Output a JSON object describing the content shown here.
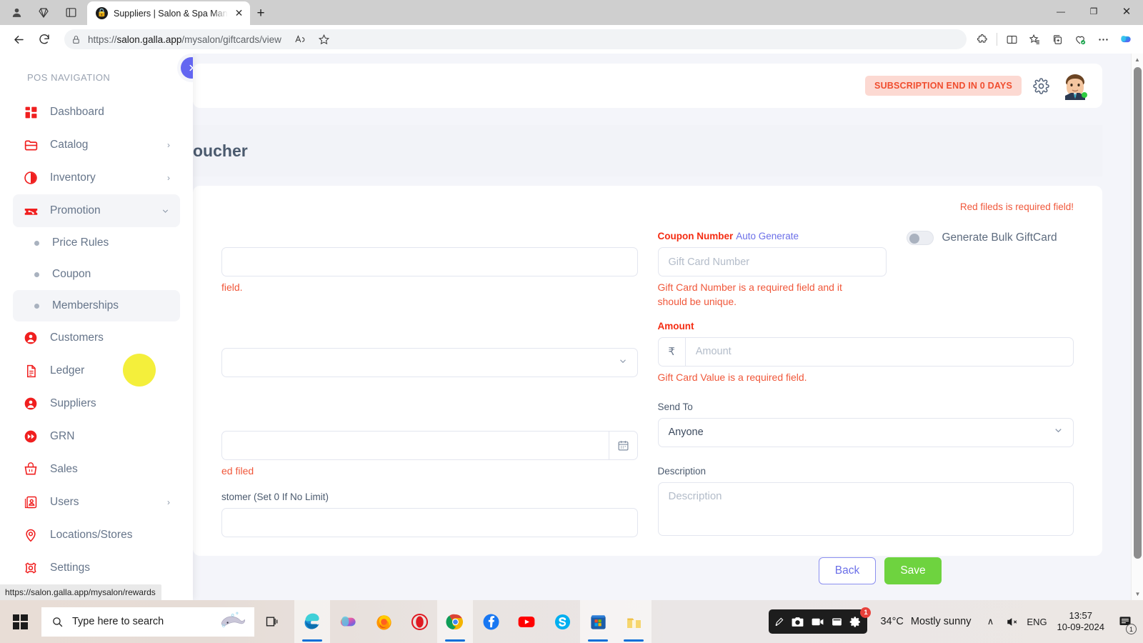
{
  "browser": {
    "tab": {
      "title": "Suppliers | Salon & Spa Managem",
      "favicon": "lock-favicon",
      "close_label": "✕"
    },
    "new_tab_label": "+",
    "window_controls": {
      "minimize": "—",
      "maximize": "❐",
      "close": "✕"
    },
    "address": {
      "scheme": "https://",
      "host": "salon.galla.app",
      "path": "/mysalon/giftcards/view"
    },
    "nav": {
      "back": "back-arrow",
      "reload": "reload-arrow"
    },
    "icons": [
      "read-aloud-icon",
      "favorite-star-icon",
      "extensions-icon",
      "split-screen-icon",
      "collections-icon",
      "add-to-collection-icon",
      "browser-essentials-icon",
      "settings-more-icon",
      "copilot-icon"
    ]
  },
  "sidebar": {
    "heading": "POS NAVIGATION",
    "toggle_icon": "chevron-right-icon",
    "items": [
      {
        "label": "Dashboard",
        "icon": "dashboard-icon",
        "chevron": "",
        "active": false,
        "type": "item"
      },
      {
        "label": "Catalog",
        "icon": "catalog-folder-icon",
        "chevron": "›",
        "active": false,
        "type": "item"
      },
      {
        "label": "Inventory",
        "icon": "inventory-circle-icon",
        "chevron": "›",
        "active": false,
        "type": "item"
      },
      {
        "label": "Promotion",
        "icon": "promotion-tag-icon",
        "chevron": "⌄",
        "active": true,
        "type": "item"
      },
      {
        "label": "Price Rules",
        "icon": "bullet-dot",
        "chevron": "",
        "active": false,
        "type": "sub"
      },
      {
        "label": "Coupon",
        "icon": "bullet-dot",
        "chevron": "",
        "active": false,
        "type": "sub"
      },
      {
        "label": "Memberships",
        "icon": "bullet-dot",
        "chevron": "",
        "active": true,
        "type": "sub"
      },
      {
        "label": "Customers",
        "icon": "customers-person-icon",
        "chevron": "",
        "active": false,
        "type": "item"
      },
      {
        "label": "Ledger",
        "icon": "ledger-document-icon",
        "chevron": "",
        "active": false,
        "type": "item"
      },
      {
        "label": "Suppliers",
        "icon": "suppliers-person-icon",
        "chevron": "",
        "active": false,
        "type": "item"
      },
      {
        "label": "GRN",
        "icon": "grn-forward-icon",
        "chevron": "",
        "active": false,
        "type": "item"
      },
      {
        "label": "Sales",
        "icon": "sales-basket-icon",
        "chevron": "",
        "active": false,
        "type": "item"
      },
      {
        "label": "Users",
        "icon": "users-card-icon",
        "chevron": "›",
        "active": false,
        "type": "item"
      },
      {
        "label": "Locations/Stores",
        "icon": "location-pin-icon",
        "chevron": "",
        "active": false,
        "type": "item"
      },
      {
        "label": "Settings",
        "icon": "settings-gear-icon",
        "chevron": "",
        "active": false,
        "type": "item"
      }
    ]
  },
  "header": {
    "subscription_badge": "SUBSCRIPTION END IN 0 DAYS",
    "gear_icon": "gear-icon",
    "avatar": "user-avatar"
  },
  "page": {
    "title_visible": "oucher",
    "required_note": "Red fileds is required field!"
  },
  "form": {
    "left": {
      "field1_error": "field.",
      "select_placeholder": "",
      "date_error": "ed filed",
      "limit_label": "stomer (Set 0 If No Limit)",
      "calendar_icon": "calendar-icon",
      "chevron_icon": "chevron-down-icon"
    },
    "coupon": {
      "label": "Coupon Number",
      "auto_generate": "Auto Generate",
      "placeholder": "Gift Card Number",
      "value": "",
      "error": "Gift Card Number is a required field and it should be unique."
    },
    "bulk_toggle": {
      "label": "Generate Bulk GiftCard",
      "on": false
    },
    "amount": {
      "label": "Amount",
      "currency": "₹",
      "placeholder": "Amount",
      "value": "",
      "error": "Gift Card Value is a required field."
    },
    "send_to": {
      "label": "Send To",
      "value": "Anyone",
      "chevron": "chevron-down-icon"
    },
    "description": {
      "label": "Description",
      "placeholder": "Description",
      "value": ""
    }
  },
  "footer": {
    "back_label": "Back",
    "save_label": "Save"
  },
  "status_bar": {
    "url": "https://salon.galla.app/mysalon/rewards"
  },
  "taskbar": {
    "start_icon": "windows-start-icon",
    "search_placeholder": "Type here to search",
    "search_icon": "search-icon",
    "search_mascot": "stingray-icon",
    "task_view_icon": "task-view-icon",
    "apps": [
      {
        "name": "edge-icon",
        "active": true
      },
      {
        "name": "copilot-icon",
        "active": false
      },
      {
        "name": "firefox-icon",
        "active": false
      },
      {
        "name": "opera-icon",
        "active": false
      },
      {
        "name": "chrome-icon",
        "active": true
      },
      {
        "name": "facebook-icon",
        "active": false
      },
      {
        "name": "youtube-icon",
        "active": false
      },
      {
        "name": "skype-icon",
        "active": false
      },
      {
        "name": "microsoft-store-icon",
        "active": true
      },
      {
        "name": "folder-app-icon",
        "active": true
      }
    ],
    "recorder": {
      "icons": [
        "screenshot-pen-icon",
        "camera-icon",
        "video-camera-icon",
        "window-capture-icon",
        "recorder-gear-icon"
      ],
      "badge": "1"
    },
    "weather": {
      "temp": "34°C",
      "desc": "Mostly sunny"
    },
    "tray": {
      "chevron": "∧",
      "volume": "mute-volume-icon",
      "language": "ENG"
    },
    "clock": {
      "time": "13:57",
      "date": "10-09-2024"
    },
    "notifications": {
      "icon": "notification-icon",
      "count": "1"
    }
  }
}
